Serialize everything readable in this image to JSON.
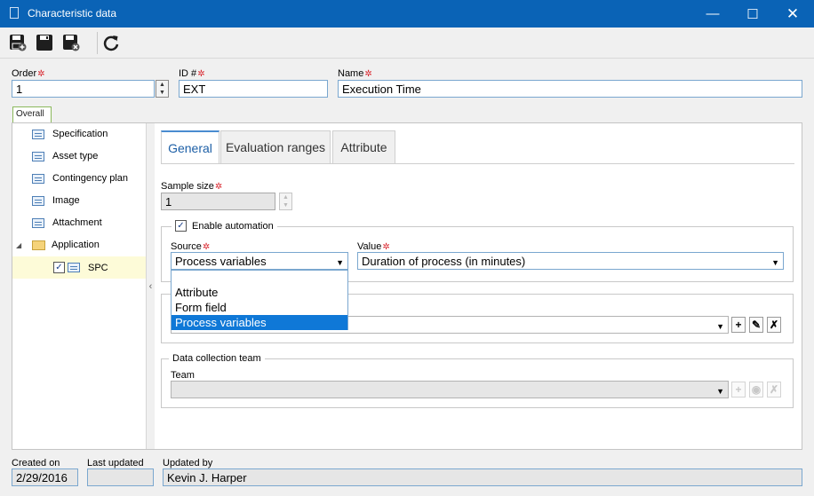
{
  "window": {
    "title": "Characteristic data"
  },
  "toolbar": {
    "save_new": "save-new-icon",
    "save": "save-icon",
    "save_close": "save-close-icon",
    "refresh": "refresh-icon"
  },
  "form": {
    "order_label": "Order",
    "order_value": "1",
    "id_label": "ID #",
    "id_value": "EXT",
    "name_label": "Name",
    "name_value": "Execution Time"
  },
  "outer_tab": "Overall",
  "tree": {
    "items": [
      "Specification",
      "Asset type",
      "Contingency plan",
      "Image",
      "Attachment",
      "Application",
      "SPC"
    ]
  },
  "tabs": [
    "General",
    "Evaluation ranges",
    "Attribute"
  ],
  "general": {
    "sample_size_label": "Sample size",
    "sample_size_value": "1",
    "automation_label": "Enable automation",
    "source_label": "Source",
    "source_value": "Process variables",
    "value_label": "Value",
    "value_value": "Duration of process (in minutes)",
    "dropdown_options": [
      "Attribute",
      "Form field",
      "Process variables"
    ],
    "team_group_label": "Data collection team",
    "team_label": "Team",
    "team_value": ""
  },
  "footer": {
    "created_on_label": "Created on",
    "created_on_value": "2/29/2016",
    "last_updated_label": "Last updated",
    "last_updated_value": "",
    "updated_by_label": "Updated by",
    "updated_by_value": "Kevin J. Harper"
  }
}
